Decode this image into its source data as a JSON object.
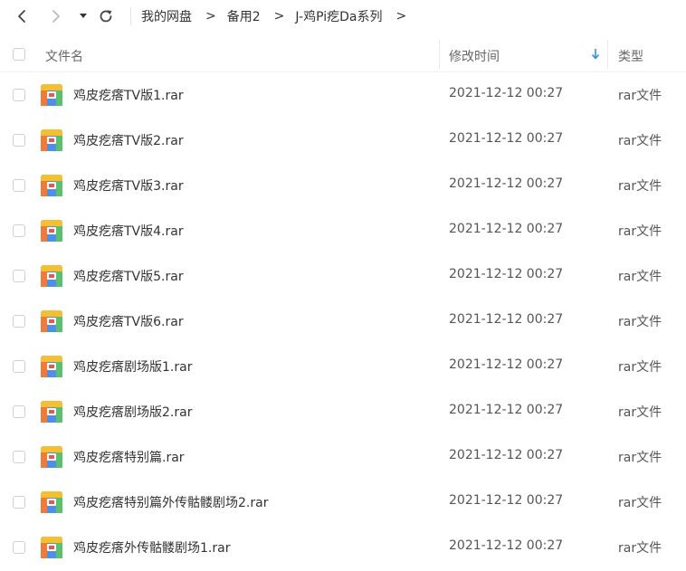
{
  "breadcrumb": {
    "items": [
      "我的网盘",
      "备用2",
      "J-鸡Pi疙Da系列"
    ],
    "separator": ">"
  },
  "header": {
    "name": "文件名",
    "time": "修改时间",
    "type": "类型"
  },
  "files": [
    {
      "name": "鸡皮疙瘩TV版1.rar",
      "time": "2021-12-12 00:27",
      "type": "rar文件"
    },
    {
      "name": "鸡皮疙瘩TV版2.rar",
      "time": "2021-12-12 00:27",
      "type": "rar文件"
    },
    {
      "name": "鸡皮疙瘩TV版3.rar",
      "time": "2021-12-12 00:27",
      "type": "rar文件"
    },
    {
      "name": "鸡皮疙瘩TV版4.rar",
      "time": "2021-12-12 00:27",
      "type": "rar文件"
    },
    {
      "name": "鸡皮疙瘩TV版5.rar",
      "time": "2021-12-12 00:27",
      "type": "rar文件"
    },
    {
      "name": "鸡皮疙瘩TV版6.rar",
      "time": "2021-12-12 00:27",
      "type": "rar文件"
    },
    {
      "name": "鸡皮疙瘩剧场版1.rar",
      "time": "2021-12-12 00:27",
      "type": "rar文件"
    },
    {
      "name": "鸡皮疙瘩剧场版2.rar",
      "time": "2021-12-12 00:27",
      "type": "rar文件"
    },
    {
      "name": "鸡皮疙瘩特别篇.rar",
      "time": "2021-12-12 00:27",
      "type": "rar文件"
    },
    {
      "name": "鸡皮疙瘩特别篇外传骷髅剧场2.rar",
      "time": "2021-12-12 00:27",
      "type": "rar文件"
    },
    {
      "name": "鸡皮疙瘩外传骷髅剧场1.rar",
      "time": "2021-12-12 00:27",
      "type": "rar文件"
    }
  ],
  "colors": {
    "sort_arrow": "#2b8ff0",
    "icon_top": "#f4bf34",
    "icon_left": "#f07a3a",
    "icon_blue": "#4f8fe8",
    "icon_green": "#5bc06e"
  }
}
